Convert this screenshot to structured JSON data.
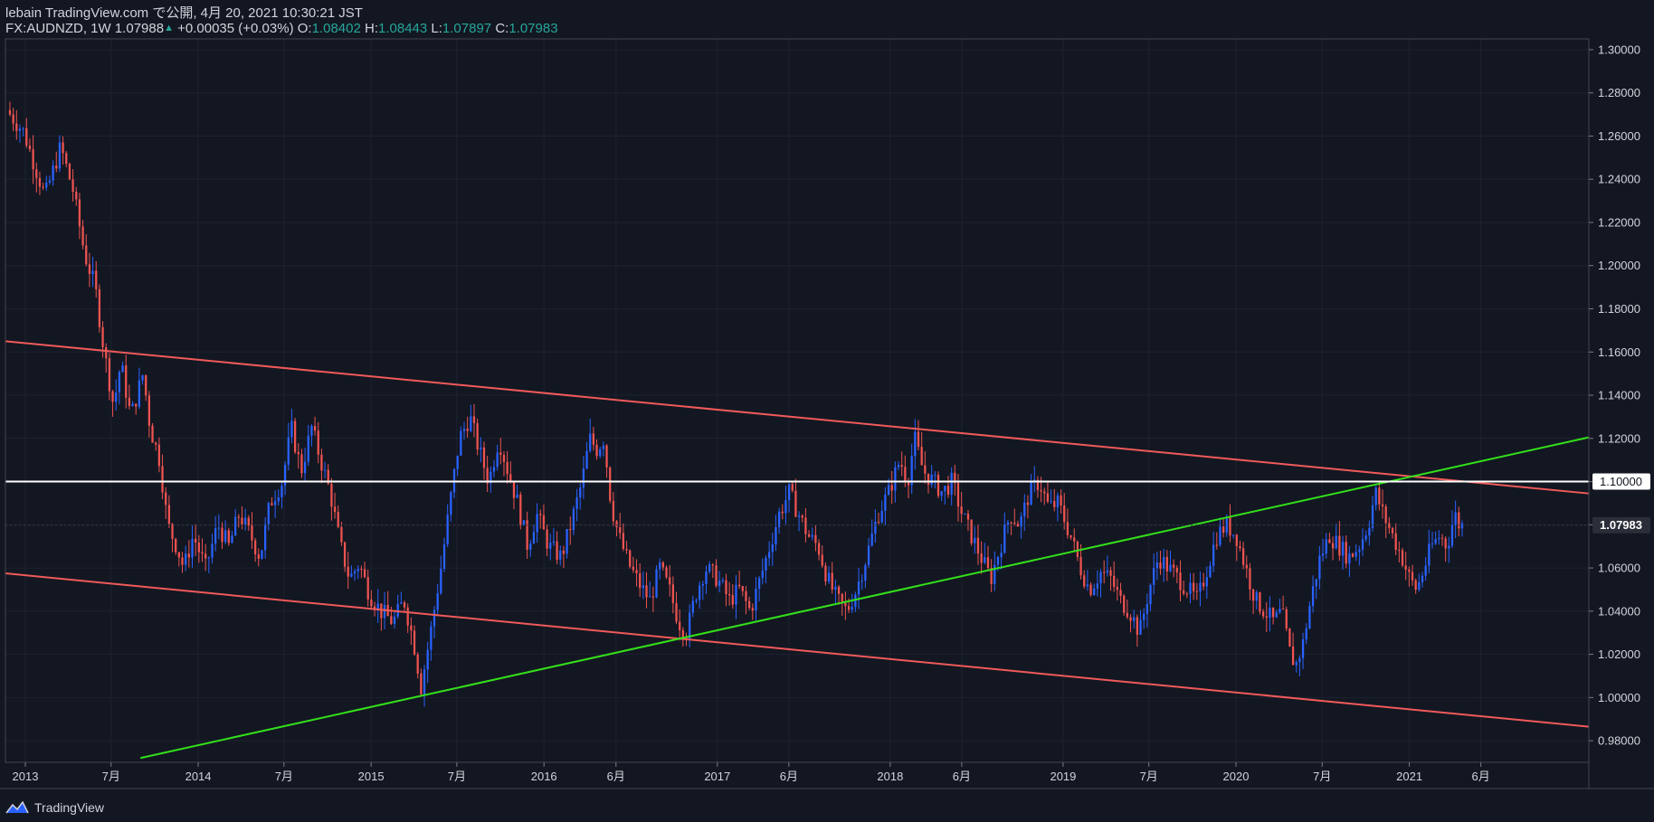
{
  "header": {
    "publisher": "lebain TradingView.com で公開, 4月 20, 2021 10:30:21 JST",
    "symbol": "FX:AUDNZD, 1W",
    "last": "1.07988",
    "change": "+0.00035 (+0.03%)",
    "o_label": "O:",
    "o_value": "1.08402",
    "h_label": "H:",
    "h_value": "1.08443",
    "l_label": "L:",
    "l_value": "1.07897",
    "c_label": "C:",
    "c_value": "1.07983"
  },
  "footer": {
    "brand": "TradingView",
    "logo_icon": "tradingview-logo-icon"
  },
  "colors": {
    "background": "#131722",
    "up_candle": "#2962ff",
    "down_candle": "#ef5350",
    "channel_line": "#f05a5a",
    "support_line": "#33e01a",
    "level_line": "#ffffff",
    "grid": "#1e2230"
  },
  "chart_data": {
    "type": "candlestick",
    "symbol": "FX:AUDNZD",
    "timeframe": "1W",
    "y_range": [
      0.97,
      1.305
    ],
    "x_range": [
      "2012-11-20",
      "2022-01-15"
    ],
    "y_ticks": [
      "1.30000",
      "1.28000",
      "1.26000",
      "1.24000",
      "1.22000",
      "1.20000",
      "1.18000",
      "1.16000",
      "1.14000",
      "1.12000",
      "1.10000",
      "1.08000",
      "1.06000",
      "1.04000",
      "1.02000",
      "1.00000",
      "0.98000"
    ],
    "x_ticks": [
      {
        "label": "2013",
        "date": "2013-01-01"
      },
      {
        "label": "7月",
        "date": "2013-07-01"
      },
      {
        "label": "2014",
        "date": "2014-01-01"
      },
      {
        "label": "7月",
        "date": "2014-07-01"
      },
      {
        "label": "2015",
        "date": "2015-01-01"
      },
      {
        "label": "7月",
        "date": "2015-07-01"
      },
      {
        "label": "2016",
        "date": "2016-01-01"
      },
      {
        "label": "6月",
        "date": "2016-06-01"
      },
      {
        "label": "2017",
        "date": "2017-01-01"
      },
      {
        "label": "6月",
        "date": "2017-06-01"
      },
      {
        "label": "2018",
        "date": "2018-01-01"
      },
      {
        "label": "6月",
        "date": "2018-06-01"
      },
      {
        "label": "2019",
        "date": "2019-01-01"
      },
      {
        "label": "7月",
        "date": "2019-07-01"
      },
      {
        "label": "2020",
        "date": "2020-01-01"
      },
      {
        "label": "7月",
        "date": "2020-07-01"
      },
      {
        "label": "2021",
        "date": "2021-01-01"
      },
      {
        "label": "6月",
        "date": "2021-06-01"
      }
    ],
    "price_path": [
      [
        "2012-11-26",
        1.272
      ],
      [
        "2013-01-01",
        1.262
      ],
      [
        "2013-02-15",
        1.232
      ],
      [
        "2013-03-20",
        1.255
      ],
      [
        "2013-04-15",
        1.235
      ],
      [
        "2013-05-10",
        1.205
      ],
      [
        "2013-06-01",
        1.19
      ],
      [
        "2013-06-20",
        1.16
      ],
      [
        "2013-07-10",
        1.135
      ],
      [
        "2013-07-25",
        1.155
      ],
      [
        "2013-08-15",
        1.13
      ],
      [
        "2013-09-10",
        1.15
      ],
      [
        "2013-09-25",
        1.125
      ],
      [
        "2013-10-15",
        1.11
      ],
      [
        "2013-11-01",
        1.08
      ],
      [
        "2013-11-20",
        1.07
      ],
      [
        "2013-12-05",
        1.06
      ],
      [
        "2013-12-25",
        1.075
      ],
      [
        "2014-01-20",
        1.06
      ],
      [
        "2014-02-15",
        1.08
      ],
      [
        "2014-03-10",
        1.07
      ],
      [
        "2014-04-01",
        1.085
      ],
      [
        "2014-04-25",
        1.075
      ],
      [
        "2014-05-15",
        1.065
      ],
      [
        "2014-06-05",
        1.09
      ],
      [
        "2014-07-01",
        1.1
      ],
      [
        "2014-07-20",
        1.125
      ],
      [
        "2014-08-10",
        1.105
      ],
      [
        "2014-09-01",
        1.125
      ],
      [
        "2014-09-20",
        1.11
      ],
      [
        "2014-10-10",
        1.095
      ],
      [
        "2014-11-01",
        1.07
      ],
      [
        "2014-11-20",
        1.055
      ],
      [
        "2014-12-10",
        1.062
      ],
      [
        "2015-01-01",
        1.048
      ],
      [
        "2015-01-25",
        1.04
      ],
      [
        "2015-02-20",
        1.035
      ],
      [
        "2015-03-15",
        1.045
      ],
      [
        "2015-04-05",
        1.025
      ],
      [
        "2015-04-20",
        1.005
      ],
      [
        "2015-05-10",
        1.03
      ],
      [
        "2015-06-01",
        1.06
      ],
      [
        "2015-06-20",
        1.09
      ],
      [
        "2015-07-10",
        1.12
      ],
      [
        "2015-08-01",
        1.13
      ],
      [
        "2015-08-20",
        1.115
      ],
      [
        "2015-09-10",
        1.1
      ],
      [
        "2015-10-01",
        1.12
      ],
      [
        "2015-10-20",
        1.105
      ],
      [
        "2015-11-10",
        1.09
      ],
      [
        "2015-12-01",
        1.07
      ],
      [
        "2015-12-20",
        1.085
      ],
      [
        "2016-01-15",
        1.07
      ],
      [
        "2016-02-10",
        1.065
      ],
      [
        "2016-03-01",
        1.08
      ],
      [
        "2016-03-25",
        1.1
      ],
      [
        "2016-04-10",
        1.12
      ],
      [
        "2016-04-25",
        1.115
      ],
      [
        "2016-05-10",
        1.12
      ],
      [
        "2016-05-25",
        1.09
      ],
      [
        "2016-06-10",
        1.075
      ],
      [
        "2016-07-01",
        1.062
      ],
      [
        "2016-07-25",
        1.052
      ],
      [
        "2016-08-15",
        1.045
      ],
      [
        "2016-09-05",
        1.06
      ],
      [
        "2016-09-25",
        1.05
      ],
      [
        "2016-10-15",
        1.035
      ],
      [
        "2016-11-01",
        1.03
      ],
      [
        "2016-11-20",
        1.048
      ],
      [
        "2016-12-10",
        1.06
      ],
      [
        "2017-01-05",
        1.055
      ],
      [
        "2017-01-30",
        1.045
      ],
      [
        "2017-02-20",
        1.05
      ],
      [
        "2017-03-15",
        1.04
      ],
      [
        "2017-04-05",
        1.055
      ],
      [
        "2017-04-25",
        1.07
      ],
      [
        "2017-05-15",
        1.085
      ],
      [
        "2017-06-05",
        1.095
      ],
      [
        "2017-06-25",
        1.085
      ],
      [
        "2017-07-15",
        1.075
      ],
      [
        "2017-08-05",
        1.07
      ],
      [
        "2017-08-25",
        1.055
      ],
      [
        "2017-09-15",
        1.045
      ],
      [
        "2017-10-05",
        1.04
      ],
      [
        "2017-10-25",
        1.05
      ],
      [
        "2017-11-15",
        1.065
      ],
      [
        "2017-12-10",
        1.085
      ],
      [
        "2018-01-01",
        1.095
      ],
      [
        "2018-01-25",
        1.11
      ],
      [
        "2018-02-10",
        1.1
      ],
      [
        "2018-02-25",
        1.12
      ],
      [
        "2018-03-15",
        1.105
      ],
      [
        "2018-04-05",
        1.1
      ],
      [
        "2018-04-25",
        1.095
      ],
      [
        "2018-05-15",
        1.1
      ],
      [
        "2018-06-05",
        1.085
      ],
      [
        "2018-06-25",
        1.075
      ],
      [
        "2018-07-15",
        1.065
      ],
      [
        "2018-08-05",
        1.055
      ],
      [
        "2018-08-25",
        1.07
      ],
      [
        "2018-09-15",
        1.085
      ],
      [
        "2018-10-05",
        1.08
      ],
      [
        "2018-10-25",
        1.095
      ],
      [
        "2018-11-15",
        1.1
      ],
      [
        "2018-12-05",
        1.088
      ],
      [
        "2018-12-25",
        1.09
      ],
      [
        "2019-01-20",
        1.075
      ],
      [
        "2019-02-10",
        1.06
      ],
      [
        "2019-03-01",
        1.05
      ],
      [
        "2019-03-25",
        1.058
      ],
      [
        "2019-04-15",
        1.055
      ],
      [
        "2019-05-05",
        1.045
      ],
      [
        "2019-05-25",
        1.04
      ],
      [
        "2019-06-15",
        1.03
      ],
      [
        "2019-07-05",
        1.05
      ],
      [
        "2019-07-25",
        1.065
      ],
      [
        "2019-08-15",
        1.06
      ],
      [
        "2019-09-05",
        1.055
      ],
      [
        "2019-09-25",
        1.05
      ],
      [
        "2019-10-15",
        1.045
      ],
      [
        "2019-11-05",
        1.06
      ],
      [
        "2019-11-25",
        1.075
      ],
      [
        "2019-12-15",
        1.08
      ],
      [
        "2020-01-05",
        1.075
      ],
      [
        "2020-01-25",
        1.06
      ],
      [
        "2020-02-15",
        1.045
      ],
      [
        "2020-03-05",
        1.04
      ],
      [
        "2020-03-25",
        1.035
      ],
      [
        "2020-04-10",
        1.04
      ],
      [
        "2020-04-28",
        1.02
      ],
      [
        "2020-05-10",
        1.015
      ],
      [
        "2020-05-25",
        1.025
      ],
      [
        "2020-06-10",
        1.045
      ],
      [
        "2020-06-30",
        1.065
      ],
      [
        "2020-07-20",
        1.075
      ],
      [
        "2020-08-10",
        1.07
      ],
      [
        "2020-08-30",
        1.065
      ],
      [
        "2020-09-20",
        1.07
      ],
      [
        "2020-10-10",
        1.08
      ],
      [
        "2020-10-25",
        1.095
      ],
      [
        "2020-11-10",
        1.085
      ],
      [
        "2020-11-30",
        1.075
      ],
      [
        "2020-12-20",
        1.065
      ],
      [
        "2021-01-05",
        1.055
      ],
      [
        "2021-01-20",
        1.05
      ],
      [
        "2021-02-05",
        1.06
      ],
      [
        "2021-02-20",
        1.07
      ],
      [
        "2021-03-10",
        1.075
      ],
      [
        "2021-03-25",
        1.07
      ],
      [
        "2021-04-10",
        1.085
      ],
      [
        "2021-04-20",
        1.07983
      ]
    ],
    "trendlines": [
      {
        "name": "upper-channel",
        "color": "#f05a5a",
        "points": [
          [
            "2012-11-20",
            1.165
          ],
          [
            "2022-01-15",
            1.0945
          ]
        ]
      },
      {
        "name": "lower-channel",
        "color": "#f05a5a",
        "points": [
          [
            "2012-11-20",
            1.0575
          ],
          [
            "2022-01-15",
            0.9865
          ]
        ]
      },
      {
        "name": "rising-support",
        "color": "#33e01a",
        "points": [
          [
            "2013-09-01",
            0.972
          ],
          [
            "2022-01-15",
            1.1205
          ]
        ]
      }
    ],
    "horizontal_levels": [
      {
        "value": 1.1,
        "label": "1.10000",
        "color": "#ffffff"
      }
    ],
    "last_price": {
      "value": 1.07983,
      "label": "1.07983"
    }
  }
}
